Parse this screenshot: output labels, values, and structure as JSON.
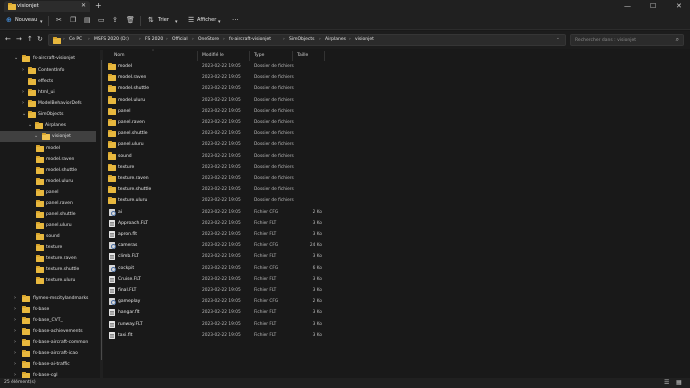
{
  "window": {
    "tab_title": "visionjet",
    "new_tab_icon": "plus-icon",
    "controls": [
      "minimize-icon",
      "maximize-icon",
      "close-icon"
    ]
  },
  "commands": {
    "new_label": "Nouveau",
    "sort_label": "Trier",
    "view_label": "Afficher",
    "more_icon": "ellipsis-icon"
  },
  "address": {
    "crumbs": [
      "Ce PC",
      "MSFS 2020 (D:)",
      "FS 2020",
      "Official",
      "OneStore",
      "fs-aircraft-visionjet",
      "SimObjects",
      "Airplanes",
      "visionjet"
    ],
    "search_placeholder": "Rechercher dans : visionjet"
  },
  "tree": [
    {
      "label": "fs-aircraft-visionjet",
      "level": 1,
      "expanded": true
    },
    {
      "label": "ContentInfo",
      "level": 2,
      "expanded": false
    },
    {
      "label": "effects",
      "level": 2,
      "expanded": null
    },
    {
      "label": "html_ui",
      "level": 2,
      "expanded": false
    },
    {
      "label": "ModelBehaviorDefs",
      "level": 2,
      "expanded": false
    },
    {
      "label": "SimObjects",
      "level": 2,
      "expanded": true
    },
    {
      "label": "Airplanes",
      "level": 3,
      "expanded": true
    },
    {
      "label": "visionjet",
      "level": 4,
      "expanded": true,
      "selected": true
    },
    {
      "label": "model",
      "level": 5
    },
    {
      "label": "model.raven",
      "level": 5
    },
    {
      "label": "model.shuttle",
      "level": 5
    },
    {
      "label": "model.uluru",
      "level": 5
    },
    {
      "label": "panel",
      "level": 5
    },
    {
      "label": "panel.raven",
      "level": 5
    },
    {
      "label": "panel.shuttle",
      "level": 5
    },
    {
      "label": "panel.uluru",
      "level": 5
    },
    {
      "label": "sound",
      "level": 5
    },
    {
      "label": "texture",
      "level": 5
    },
    {
      "label": "texture.raven",
      "level": 5
    },
    {
      "label": "texture.shuttle",
      "level": 5
    },
    {
      "label": "texture.uluru",
      "level": 5
    },
    {
      "label": "flymex-mscitylandmarks",
      "level": 1,
      "expanded": false
    },
    {
      "label": "fs-base",
      "level": 1,
      "expanded": false
    },
    {
      "label": "fs-base_CVT_",
      "level": 1,
      "expanded": false
    },
    {
      "label": "fs-base-achievements",
      "level": 1,
      "expanded": false
    },
    {
      "label": "fs-base-aircraft-common",
      "level": 1,
      "expanded": false
    },
    {
      "label": "fs-base-aircraft-icao",
      "level": 1,
      "expanded": false
    },
    {
      "label": "fs-base-ai-traffic",
      "level": 1,
      "expanded": false
    },
    {
      "label": "fs-base-cgl",
      "level": 1,
      "expanded": false
    }
  ],
  "columns": {
    "name": "Nom",
    "modified": "Modifié le",
    "type": "Type",
    "size": "Taille"
  },
  "files": [
    {
      "name": "model",
      "modified": "2023-02-22 19:05",
      "type": "Dossier de fichiers",
      "size": "",
      "kind": "folder"
    },
    {
      "name": "model.raven",
      "modified": "2023-02-22 19:05",
      "type": "Dossier de fichiers",
      "size": "",
      "kind": "folder"
    },
    {
      "name": "model.shuttle",
      "modified": "2023-02-22 19:05",
      "type": "Dossier de fichiers",
      "size": "",
      "kind": "folder"
    },
    {
      "name": "model.uluru",
      "modified": "2023-02-22 19:05",
      "type": "Dossier de fichiers",
      "size": "",
      "kind": "folder"
    },
    {
      "name": "panel",
      "modified": "2023-02-22 19:05",
      "type": "Dossier de fichiers",
      "size": "",
      "kind": "folder"
    },
    {
      "name": "panel.raven",
      "modified": "2023-02-22 19:05",
      "type": "Dossier de fichiers",
      "size": "",
      "kind": "folder"
    },
    {
      "name": "panel.shuttle",
      "modified": "2023-02-22 19:05",
      "type": "Dossier de fichiers",
      "size": "",
      "kind": "folder"
    },
    {
      "name": "panel.uluru",
      "modified": "2023-02-22 19:05",
      "type": "Dossier de fichiers",
      "size": "",
      "kind": "folder"
    },
    {
      "name": "sound",
      "modified": "2023-02-22 19:05",
      "type": "Dossier de fichiers",
      "size": "",
      "kind": "folder"
    },
    {
      "name": "texture",
      "modified": "2023-02-22 19:05",
      "type": "Dossier de fichiers",
      "size": "",
      "kind": "folder"
    },
    {
      "name": "texture.raven",
      "modified": "2023-02-22 19:05",
      "type": "Dossier de fichiers",
      "size": "",
      "kind": "folder"
    },
    {
      "name": "texture.shuttle",
      "modified": "2023-02-22 19:05",
      "type": "Dossier de fichiers",
      "size": "",
      "kind": "folder"
    },
    {
      "name": "texture.uluru",
      "modified": "2023-02-22 19:05",
      "type": "Dossier de fichiers",
      "size": "",
      "kind": "folder"
    },
    {
      "name": "ai",
      "modified": "2023-02-22 19:05",
      "type": "Fichier CFG",
      "size": "2 Ko",
      "kind": "cfg"
    },
    {
      "name": "Approach.FLT",
      "modified": "2023-02-22 19:05",
      "type": "Fichier FLT",
      "size": "3 Ko",
      "kind": "file"
    },
    {
      "name": "apron.flt",
      "modified": "2023-02-22 19:05",
      "type": "Fichier FLT",
      "size": "3 Ko",
      "kind": "file"
    },
    {
      "name": "cameras",
      "modified": "2023-02-22 19:05",
      "type": "Fichier CFG",
      "size": "24 Ko",
      "kind": "cfg"
    },
    {
      "name": "climb.FLT",
      "modified": "2023-02-22 19:05",
      "type": "Fichier FLT",
      "size": "3 Ko",
      "kind": "file"
    },
    {
      "name": "cockpit",
      "modified": "2023-02-22 19:05",
      "type": "Fichier CFG",
      "size": "6 Ko",
      "kind": "cfg"
    },
    {
      "name": "Cruise.FLT",
      "modified": "2023-02-22 19:05",
      "type": "Fichier FLT",
      "size": "3 Ko",
      "kind": "file"
    },
    {
      "name": "final.FLT",
      "modified": "2023-02-22 19:05",
      "type": "Fichier FLT",
      "size": "3 Ko",
      "kind": "file"
    },
    {
      "name": "gameplay",
      "modified": "2023-02-22 19:05",
      "type": "Fichier CFG",
      "size": "2 Ko",
      "kind": "cfg"
    },
    {
      "name": "hangar.flt",
      "modified": "2023-02-22 19:05",
      "type": "Fichier FLT",
      "size": "3 Ko",
      "kind": "file"
    },
    {
      "name": "runway.FLT",
      "modified": "2023-02-22 19:05",
      "type": "Fichier FLT",
      "size": "3 Ko",
      "kind": "file"
    },
    {
      "name": "taxi.flt",
      "modified": "2023-02-22 19:05",
      "type": "Fichier FLT",
      "size": "3 Ko",
      "kind": "file"
    }
  ],
  "status": {
    "item_count": "25 élément(s)"
  }
}
